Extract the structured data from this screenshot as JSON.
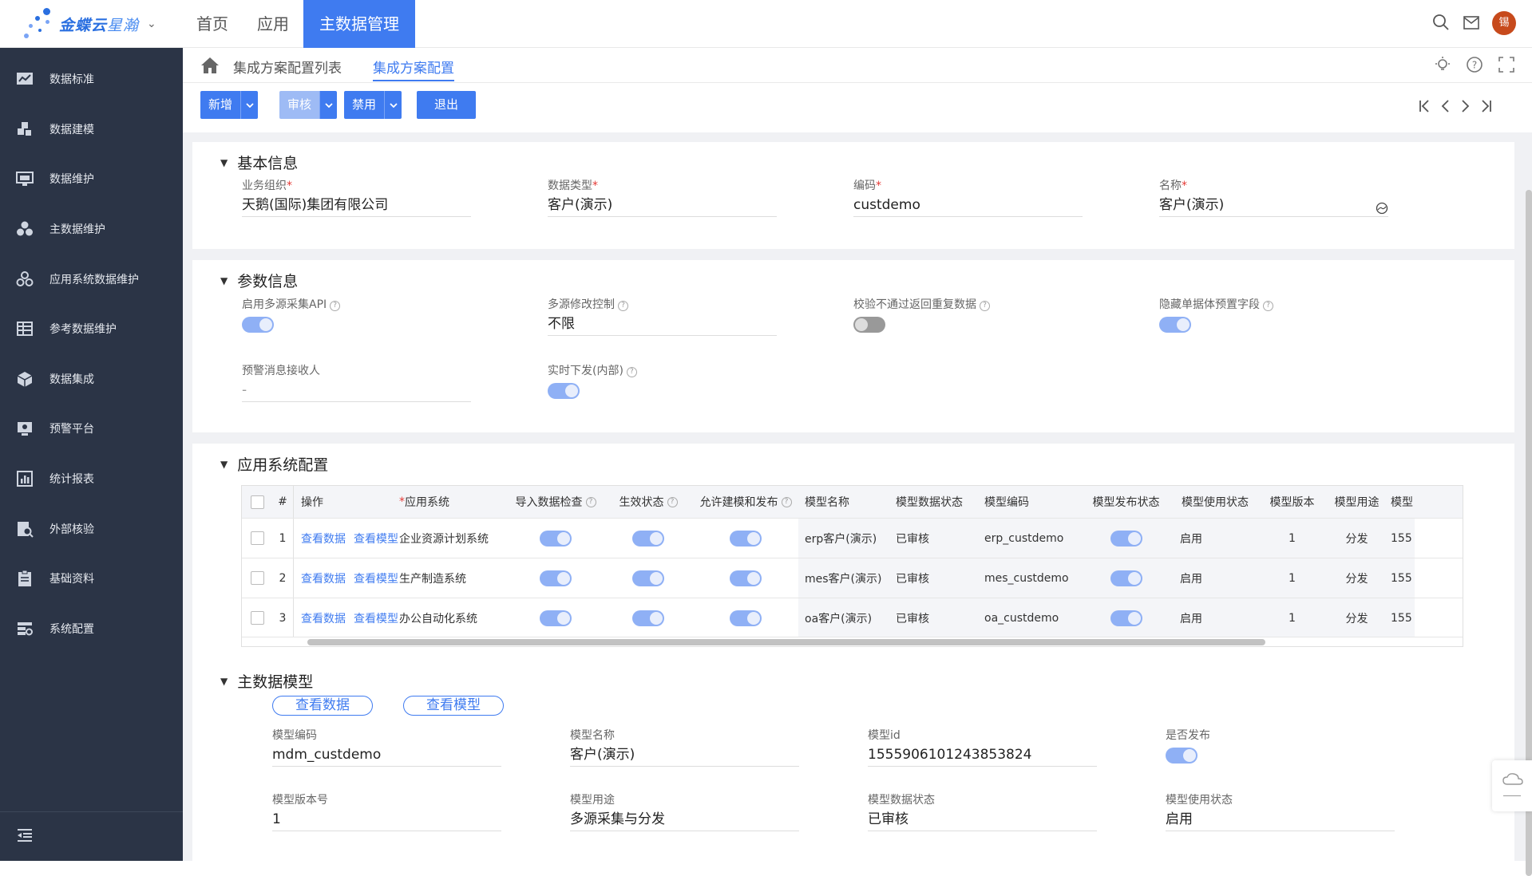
{
  "app": {
    "logo_text": "金蝶云",
    "logo_sub": "星瀚",
    "nav": [
      "首页",
      "应用",
      "主数据管理"
    ],
    "avatar": "锡"
  },
  "sidebar": {
    "items": [
      {
        "label": "数据标准",
        "icon": "chart-board-icon"
      },
      {
        "label": "数据建模",
        "icon": "puzzle-icon"
      },
      {
        "label": "数据维护",
        "icon": "monitor-icon"
      },
      {
        "label": "主数据维护",
        "icon": "cubes-icon"
      },
      {
        "label": "应用系统数据维护",
        "icon": "cluster-icon"
      },
      {
        "label": "参考数据维护",
        "icon": "table-icon"
      },
      {
        "label": "数据集成",
        "icon": "box-icon"
      },
      {
        "label": "预警平台",
        "icon": "alert-icon"
      },
      {
        "label": "统计报表",
        "icon": "report-icon"
      },
      {
        "label": "外部核验",
        "icon": "verify-icon"
      },
      {
        "label": "基础资料",
        "icon": "clipboard-icon"
      },
      {
        "label": "系统配置",
        "icon": "settings-list-icon"
      }
    ]
  },
  "breadcrumb": {
    "list": "集成方案配置列表",
    "current": "集成方案配置"
  },
  "toolbar": {
    "add": "新增",
    "audit": "审核",
    "disable": "禁用",
    "exit": "退出"
  },
  "basic": {
    "title": "基本信息",
    "org_label": "业务组织",
    "org_value": "天鹅(国际)集团有限公司",
    "type_label": "数据类型",
    "type_value": "客户(演示)",
    "code_label": "编码",
    "code_value": "custdemo",
    "name_label": "名称",
    "name_value": "客户(演示)"
  },
  "params": {
    "title": "参数信息",
    "multi_api_label": "启用多源采集API",
    "multi_api_on": true,
    "multi_edit_label": "多源修改控制",
    "multi_edit_value": "不限",
    "fail_return_label": "校验不通过返回重复数据",
    "fail_return_on": false,
    "hide_preset_label": "隐藏单据体预置字段",
    "hide_preset_on": true,
    "receiver_label": "预警消息接收人",
    "receiver_value": "-",
    "realtime_label": "实时下发(内部)",
    "realtime_on": true
  },
  "appsys": {
    "title": "应用系统配置",
    "columns": [
      "#",
      "操作",
      "应用系统",
      "导入数据检查",
      "生效状态",
      "允许建模和发布",
      "模型名称",
      "模型数据状态",
      "模型编码",
      "模型发布状态",
      "模型使用状态",
      "模型版本",
      "模型用途",
      "模型"
    ],
    "view_data": "查看数据",
    "view_model": "查看模型",
    "rows": [
      {
        "no": "1",
        "system": "企业资源计划系统",
        "model_name": "erp客户(演示)",
        "data_status": "已审核",
        "model_code": "erp_custdemo",
        "use_status": "启用",
        "version": "1",
        "purpose": "分发",
        "id_frag": "155"
      },
      {
        "no": "2",
        "system": "生产制造系统",
        "model_name": "mes客户(演示)",
        "data_status": "已审核",
        "model_code": "mes_custdemo",
        "use_status": "启用",
        "version": "1",
        "purpose": "分发",
        "id_frag": "155"
      },
      {
        "no": "3",
        "system": "办公自动化系统",
        "model_name": "oa客户(演示)",
        "data_status": "已审核",
        "model_code": "oa_custdemo",
        "use_status": "启用",
        "version": "1",
        "purpose": "分发",
        "id_frag": "155"
      }
    ]
  },
  "master": {
    "title": "主数据模型",
    "view_data": "查看数据",
    "view_model": "查看模型",
    "code_label": "模型编码",
    "code_value": "mdm_custdemo",
    "name_label": "模型名称",
    "name_value": "客户(演示)",
    "id_label": "模型id",
    "id_value": "1555906101243853824",
    "published_label": "是否发布",
    "published_on": true,
    "version_label": "模型版本号",
    "version_value": "1",
    "purpose_label": "模型用途",
    "purpose_value": "多源采集与分发",
    "data_status_label": "模型数据状态",
    "data_status_value": "已审核",
    "use_status_label": "模型使用状态",
    "use_status_value": "启用"
  },
  "colors": {
    "primary": "#3f7bf0",
    "sidebar": "#2b3446",
    "toggle_on": "#8fb0f5",
    "required": "#e53935"
  }
}
